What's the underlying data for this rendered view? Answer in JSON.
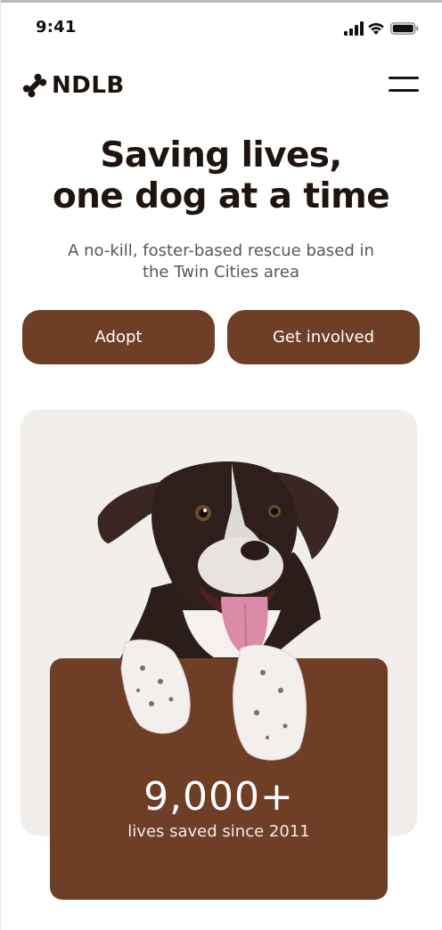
{
  "status_bar": {
    "time": "9:41",
    "icons": [
      "signal-icon",
      "wifi-icon",
      "battery-icon"
    ]
  },
  "header": {
    "logo_text": "NDLB",
    "logo_icon": "bone-icon",
    "menu_icon": "hamburger-menu-icon"
  },
  "hero": {
    "title_lines": [
      "Saving lives,",
      "one dog at a time"
    ],
    "subtitle_lines": [
      "A no-kill, foster-based rescue based in",
      "the Twin Cities area"
    ]
  },
  "actions": {
    "adopt_label": "Adopt",
    "get_involved_label": "Get involved"
  },
  "stat": {
    "value": "9,000+",
    "label": "lives saved since 2011"
  },
  "colors": {
    "brand_brown": "#6e3e26",
    "card_background": "#f1eeeb",
    "text_dark": "#1f1410",
    "text_muted": "#5c5652"
  }
}
